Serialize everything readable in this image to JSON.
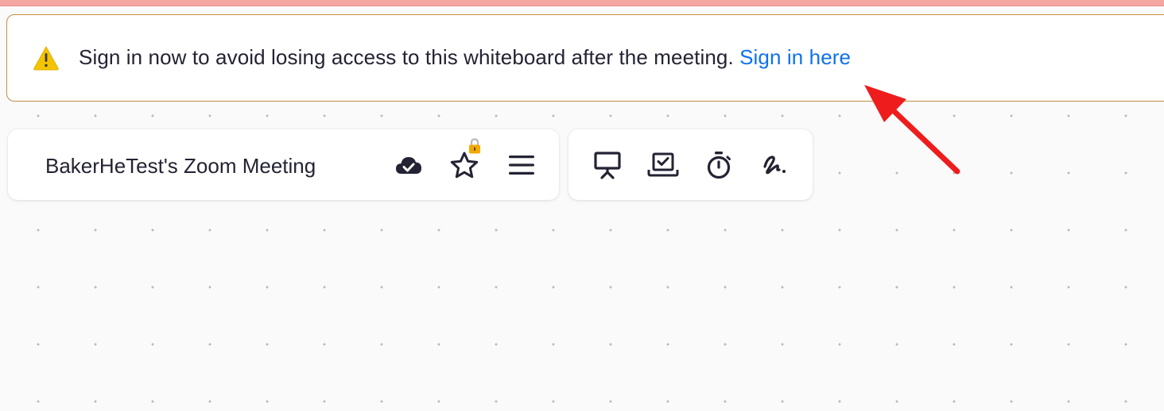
{
  "banner": {
    "message": "Sign in now to avoid losing access to this whiteboard after the meeting.",
    "link_label": "Sign in here",
    "icon": "warning-icon"
  },
  "toolbar": {
    "meeting_title": "BakerHeTest's Zoom Meeting",
    "left_buttons": [
      {
        "name": "cloud-saved-icon",
        "tooltip": ""
      },
      {
        "name": "star-icon",
        "badge": "lock-icon"
      },
      {
        "name": "hamburger-menu-icon"
      }
    ],
    "right_buttons": [
      {
        "name": "presentation-icon"
      },
      {
        "name": "laptop-check-icon"
      },
      {
        "name": "timer-icon"
      },
      {
        "name": "signature-icon"
      }
    ]
  },
  "colors": {
    "link": "#0e72ed",
    "text": "#232333",
    "banner_border": "#c88a3e",
    "warning": "#f5c400",
    "annotation_arrow": "#ee1c1c",
    "top_strip": "#f4a6a2"
  }
}
